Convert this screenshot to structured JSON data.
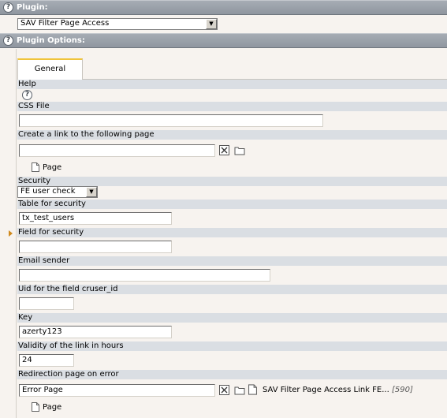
{
  "plugin_section": {
    "title": "Plugin:",
    "selected": "SAV Filter Page Access"
  },
  "options_section": {
    "title": "Plugin Options:"
  },
  "tab": {
    "label": "General"
  },
  "fields": {
    "help": {
      "label": "Help"
    },
    "css_file": {
      "label": "CSS File",
      "value": ""
    },
    "link_page": {
      "label": "Create a link to the following page",
      "value": "",
      "page_link": "Page"
    },
    "security": {
      "label": "Security",
      "selected": "FE user check"
    },
    "table_security": {
      "label": "Table for security",
      "value": "tx_test_users"
    },
    "field_security": {
      "label": "Field for security",
      "value": ""
    },
    "email_sender": {
      "label": "Email sender",
      "value": ""
    },
    "uid_cruser": {
      "label": "Uid for the field cruser_id",
      "value": ""
    },
    "key": {
      "label": "Key",
      "value": "azerty123"
    },
    "validity": {
      "label": "Validity of the link in hours",
      "value": "24"
    },
    "redirect": {
      "label": "Redirection page on error",
      "value": "Error Page",
      "record_title": "SAV Filter Page Access Link FE...",
      "record_uid": "[590]",
      "page_link": "Page"
    }
  },
  "icons": {
    "help": "help-icon",
    "clear": "clear-icon",
    "browse": "folder-icon",
    "page": "page-icon"
  }
}
